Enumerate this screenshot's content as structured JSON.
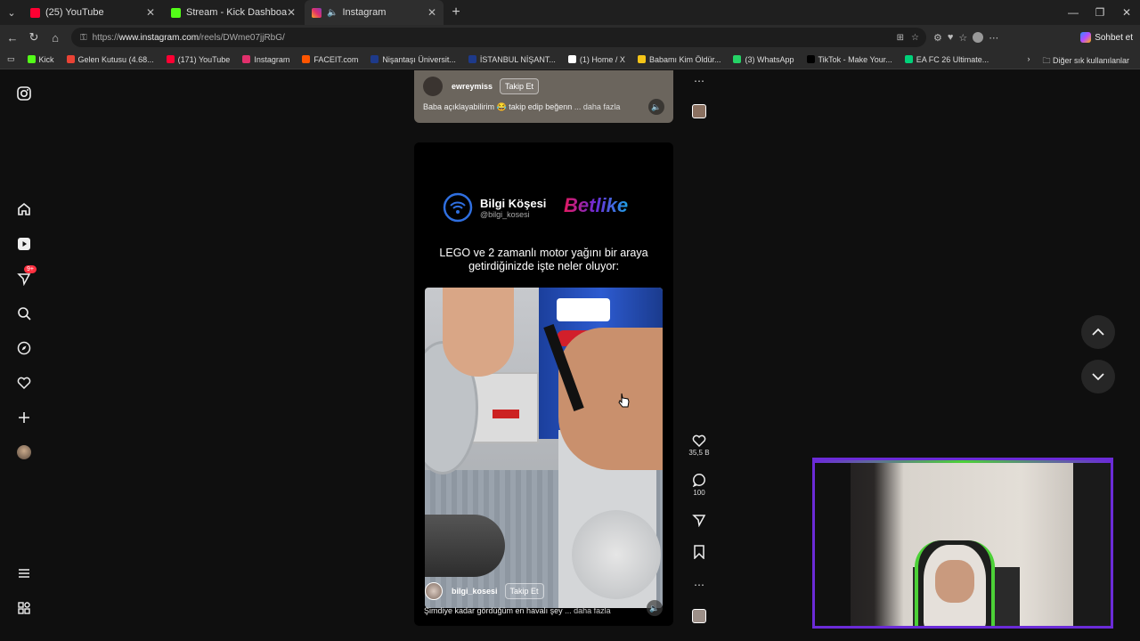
{
  "tabs": [
    {
      "title": "(25) YouTube",
      "color": "#ff0033"
    },
    {
      "title": "Stream - Kick Dashboard",
      "color": "#53fc18"
    },
    {
      "title": "Instagram",
      "color": "#e1306c"
    }
  ],
  "url": {
    "prefix": "https://",
    "domain": "www.instagram.com",
    "path": "/reels/DWme07jjRbG/"
  },
  "copilot_label": "Sohbet et",
  "bookmarks": [
    {
      "label": "Kick",
      "color": "#53fc18"
    },
    {
      "label": "Gelen Kutusu (4.68...",
      "color": "#ea4335"
    },
    {
      "label": "(171) YouTube",
      "color": "#ff0033"
    },
    {
      "label": "Instagram",
      "color": "#e1306c"
    },
    {
      "label": "FACEIT.com",
      "color": "#ff5500"
    },
    {
      "label": "Nişantaşı Üniversit...",
      "color": "#1e3a8a"
    },
    {
      "label": "İSTANBUL NİŞANT...",
      "color": "#1e3a8a"
    },
    {
      "label": "(1) Home / X",
      "color": "#ffffff"
    },
    {
      "label": "Babamı Kim Öldür...",
      "color": "#f5c518"
    },
    {
      "label": "(3) WhatsApp",
      "color": "#25d366"
    },
    {
      "label": "TikTok - Make Your...",
      "color": "#000000"
    },
    {
      "label": "EA FC 26 Ultimate...",
      "color": "#00d27a"
    }
  ],
  "other_bookmarks": "Diğer sık kullanılanlar",
  "prev_reel": {
    "username": "ewreymiss",
    "follow": "Takip Et",
    "caption": "Baba açıklayabilirim 😂 takip edip beğenn",
    "more": "... daha fazla"
  },
  "reel": {
    "brand_name": "Bilgi Köşesi",
    "brand_handle": "@bilgi_kosesi",
    "partner": "Betlike",
    "headline_line1": "LEGO ve 2 zamanlı motor yağını bir araya",
    "headline_line2": "getirdiğinizde işte neler oluyor:",
    "username": "bilgi_kosesi",
    "follow": "Takip Et",
    "caption": "Şimdiye kadar gördüğüm en havalı şey",
    "more": "... daha fazla",
    "likes": "35,5 B",
    "comments": "100"
  },
  "notifications_badge": "9+"
}
